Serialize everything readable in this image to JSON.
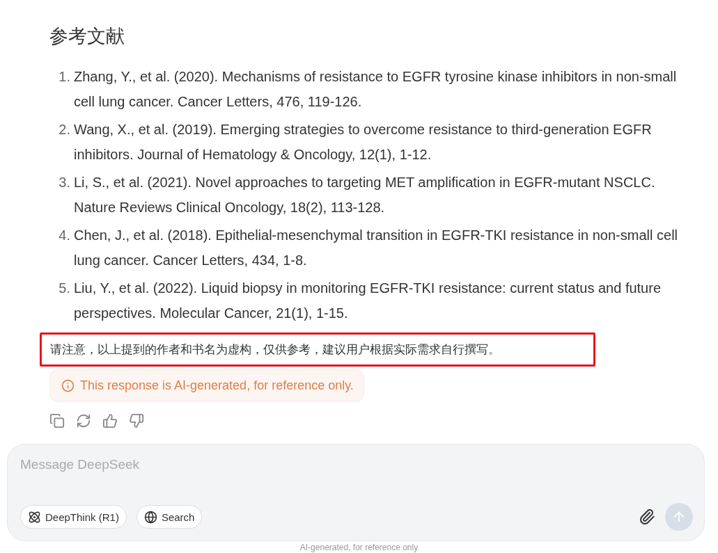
{
  "heading": "参考文献",
  "references": [
    {
      "number": "1.",
      "text": "Zhang, Y., et al. (2020). Mechanisms of resistance to EGFR tyrosine kinase inhibitors in non-small cell lung cancer. Cancer Letters, 476, 119-126."
    },
    {
      "number": "2.",
      "text": "Wang, X., et al. (2019). Emerging strategies to overcome resistance to third-generation EGFR inhibitors. Journal of Hematology & Oncology, 12(1), 1-12."
    },
    {
      "number": "3.",
      "text": "Li, S., et al. (2021). Novel approaches to targeting MET amplification in EGFR-mutant NSCLC. Nature Reviews Clinical Oncology, 18(2), 113-128."
    },
    {
      "number": "4.",
      "text": "Chen, J., et al. (2018). Epithelial-mesenchymal transition in EGFR-TKI resistance in non-small cell lung cancer. Cancer Letters, 434, 1-8."
    },
    {
      "number": "5.",
      "text": "Liu, Y., et al. (2022). Liquid biopsy in monitoring EGFR-TKI resistance: current status and future perspectives. Molecular Cancer, 21(1), 1-15."
    }
  ],
  "note": {
    "text": "请注意，以上提到的作者和书名为虚构，仅供参考，建议用户根据实际需求自行撰写。",
    "highlighted": true
  },
  "warning": "This response is AI-generated, for reference only.",
  "composer": {
    "placeholder": "Message DeepSeek",
    "buttons": [
      {
        "kind": "deepthink",
        "label": "DeepThink (R1)",
        "selected": false
      },
      {
        "kind": "search",
        "label": "Search",
        "selected": false
      }
    ],
    "send_disabled": true
  },
  "footer": "AI-generated, for reference only"
}
